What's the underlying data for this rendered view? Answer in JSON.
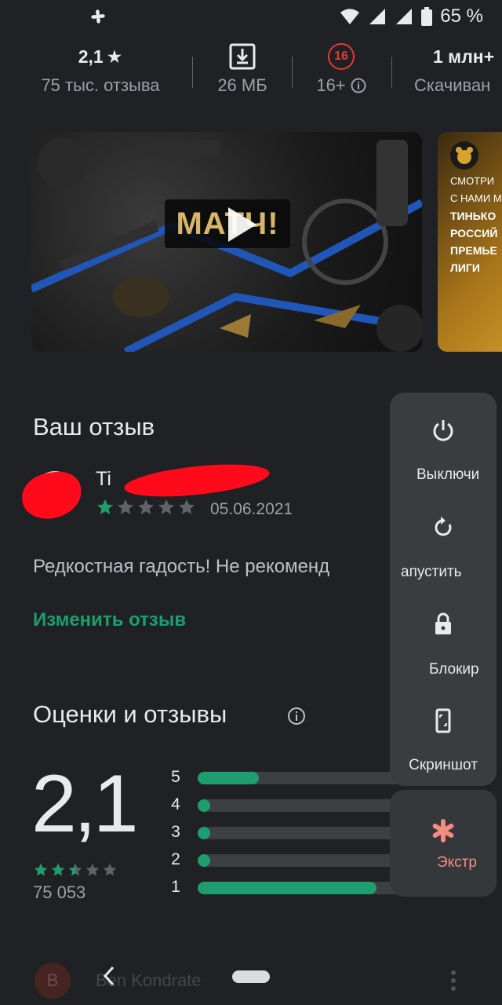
{
  "status_bar": {
    "battery": "65 %"
  },
  "stats": {
    "rating": "2,1",
    "reviews": "75 тыс. отзыва",
    "size": "26 МБ",
    "age_badge": "16",
    "age": "16+",
    "installs": "1 млн+",
    "installs_label": "Скачиван"
  },
  "carousel": {
    "logo": "МАТЧ!",
    "promo_lines": [
      "СМОТРИ",
      "С НАМИ М",
      "ТИНЬКО",
      "РОССИЙ",
      "ПРЕМЬЕ",
      "ЛИГИ"
    ]
  },
  "your_review": {
    "title": "Ваш отзыв",
    "reviewer_name": "Ti",
    "stars": 1,
    "date": "05.06.2021",
    "text": "Редкостная гадость! Не рекоменд",
    "edit_label": "Изменить отзыв"
  },
  "ratings": {
    "title": "Оценки и отзывы",
    "average": "2,1",
    "average_value": 2.5,
    "total": "75 053",
    "histogram": [
      {
        "label": "5",
        "fraction": 0.26
      },
      {
        "label": "4",
        "fraction": 0.05
      },
      {
        "label": "3",
        "fraction": 0.05
      },
      {
        "label": "2",
        "fraction": 0.05
      },
      {
        "label": "1",
        "fraction": 0.76
      }
    ]
  },
  "power_menu": {
    "power_off": "Выключи",
    "restart": "апустить",
    "lockdown": "Блокир",
    "screenshot": "Скриншот",
    "emergency": "Экстр"
  },
  "bottom": {
    "avatar_letter": "B",
    "name": "Ben Kondrate"
  },
  "colors": {
    "accent": "#1e9e6f",
    "background": "#202124",
    "redaction": "#ff0a1a"
  }
}
